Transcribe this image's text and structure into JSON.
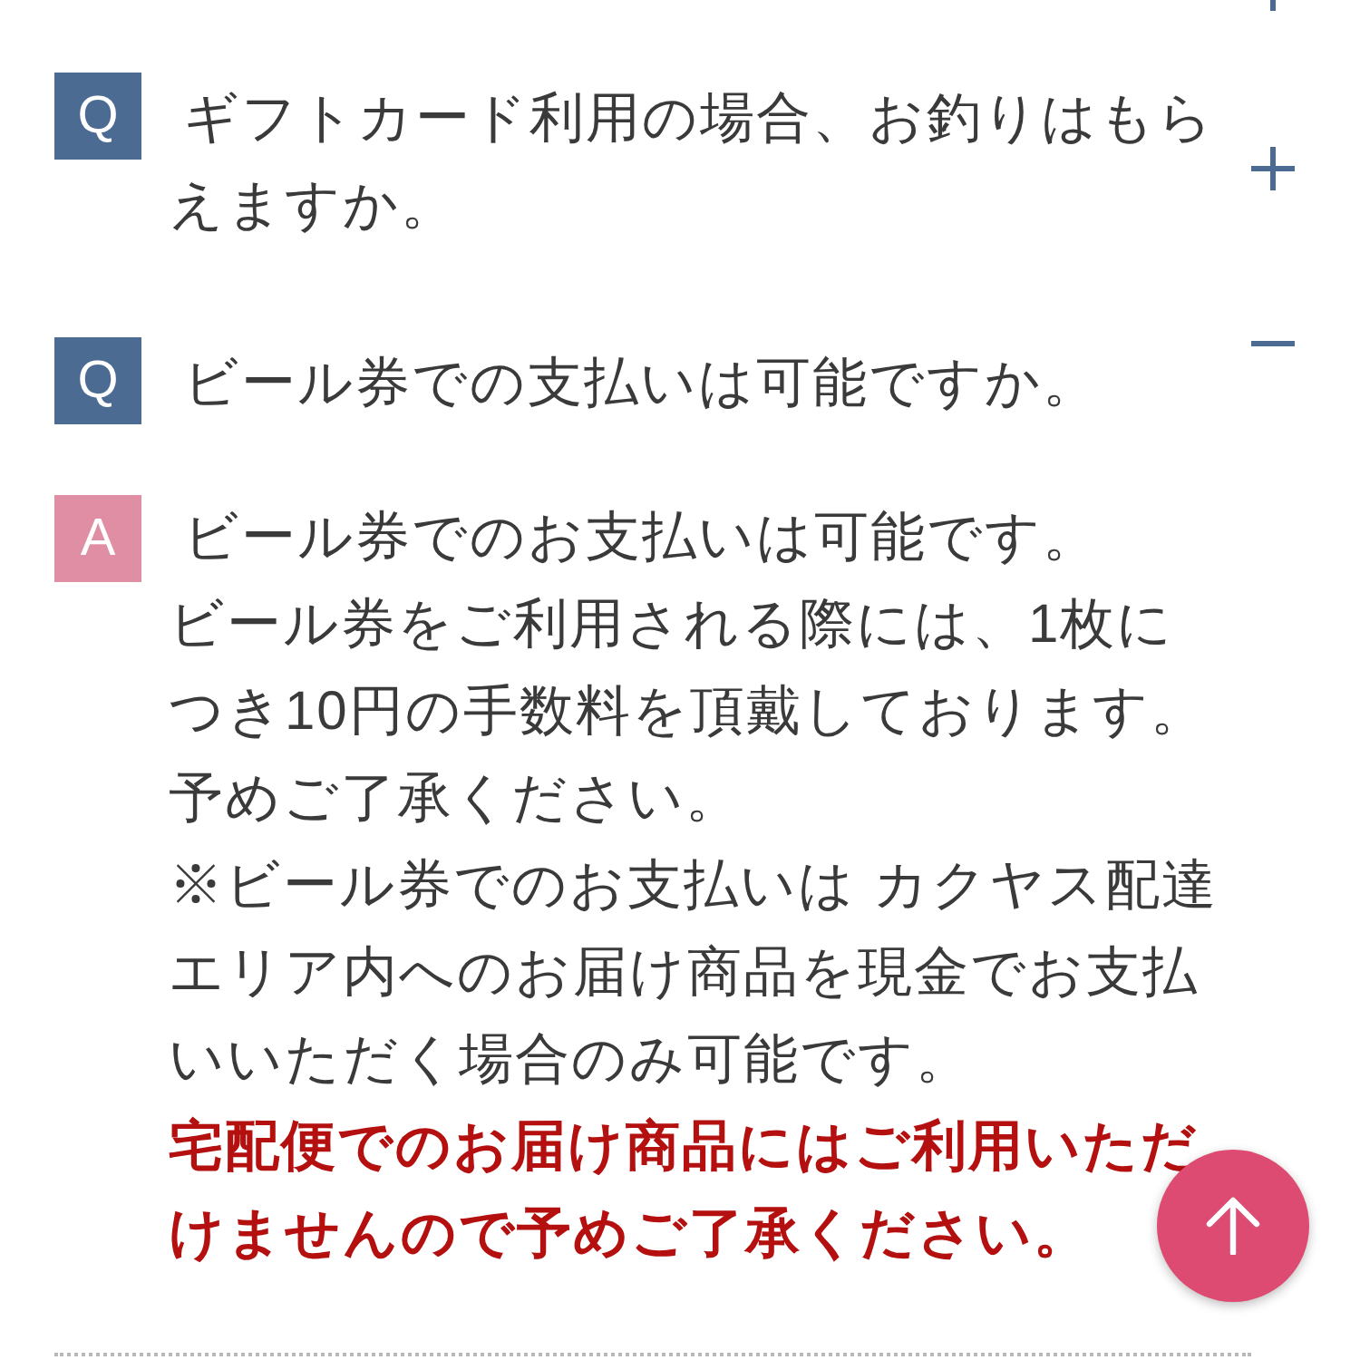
{
  "faqs": [
    {
      "expanded": false
    },
    {
      "question_badge": "Q",
      "question": "ギフトカード利用の場合、お釣りはもらえますか。",
      "expanded": false
    },
    {
      "question_badge": "Q",
      "question": "ビール券での支払いは可能ですか。",
      "expanded": true,
      "answer_badge": "A",
      "answer": [
        {
          "kind": "normal",
          "text": "ビール券でのお支払いは可能です。"
        },
        {
          "kind": "normal",
          "text": "ビール券をご利用される際には、1枚につき10円の手数料を頂戴しております。"
        },
        {
          "kind": "normal",
          "text": "予めご了承ください。"
        },
        {
          "kind": "normal",
          "text": "※ビール券でのお支払いは カクヤス配達エリア内へのお届け商品を現金でお支払いいただく場合のみ可能です。"
        },
        {
          "kind": "warning",
          "text": "宅配便でのお届け商品にはご利用いただけませんので予めご了承ください。"
        }
      ]
    }
  ]
}
